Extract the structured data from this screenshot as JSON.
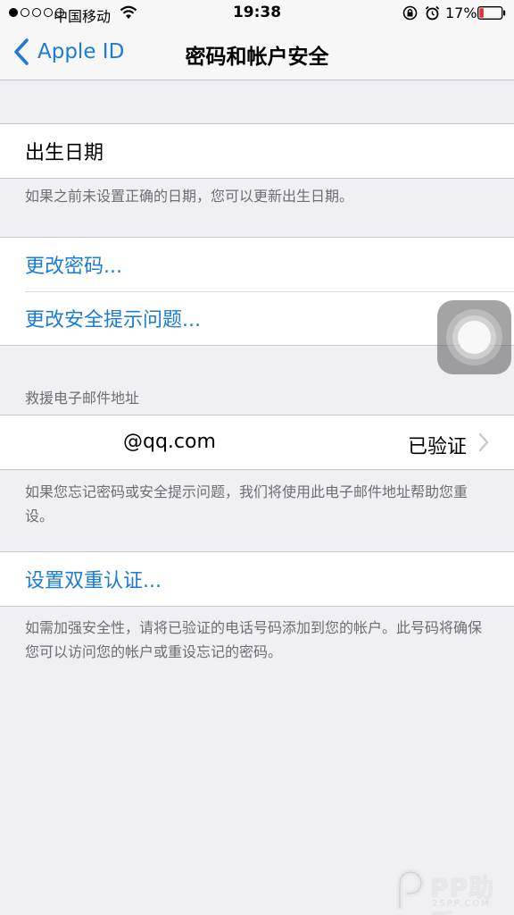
{
  "status_bar": {
    "carrier": "中国移动",
    "time": "19:38",
    "battery_percent": "17%",
    "battery_level": 0.17,
    "battery_color": "#e0303a",
    "signal_strength": 1,
    "icons": [
      "signal-icon",
      "wifi-icon",
      "rotation-lock-icon",
      "alarm-icon",
      "battery-icon"
    ]
  },
  "nav": {
    "back_label": "Apple ID",
    "title": "密码和帐户安全",
    "accent_color": "#1b7bd6"
  },
  "birthday": {
    "label": "出生日期",
    "footer": "如果之前未设置正确的日期，您可以更新出生日期。"
  },
  "password_group": {
    "change_password": "更改密码...",
    "change_security_questions": "更改安全提示问题..."
  },
  "rescue_email": {
    "header": "救援电子邮件地址",
    "email": "@qq.com",
    "status": "已验证",
    "footer": "如果您忘记密码或安全提示问题，我们将使用此电子邮件地址帮助您重设。"
  },
  "two_factor": {
    "label": "设置双重认证...",
    "footer": "如需加强安全性，请将已验证的电话号码添加到您的帐户。此号码将确保您可以访问您的帐户或重设忘记的密码。"
  },
  "watermark": {
    "brand": "PP助手",
    "site": "25PP.COM"
  }
}
